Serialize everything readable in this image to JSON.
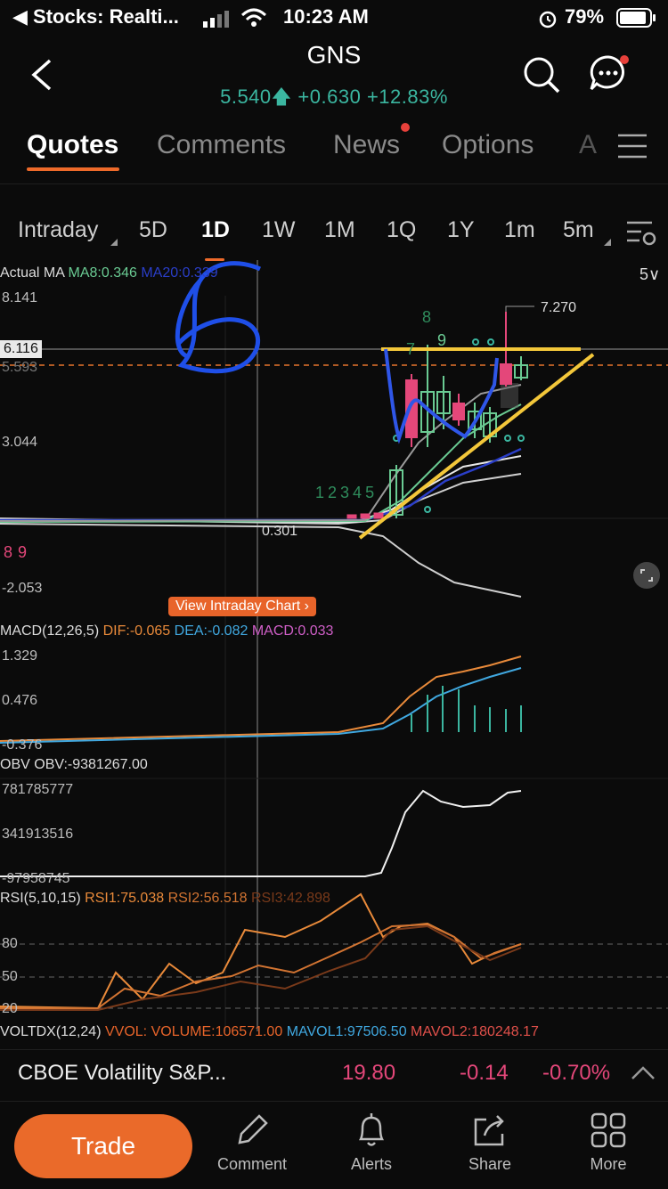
{
  "status_bar": {
    "back_app": "◀ Stocks: Realti...",
    "time": "10:23 AM",
    "battery": "79%"
  },
  "header": {
    "symbol": "GNS",
    "price": "5.540",
    "change": "+0.630",
    "change_pct": "+12.83%",
    "accent_up": "#3bb6a0"
  },
  "tabs": {
    "items": [
      "Quotes",
      "Comments",
      "News",
      "Options",
      "A"
    ],
    "active": "Quotes"
  },
  "periods": {
    "items": [
      "Intraday",
      "5D",
      "1D",
      "1W",
      "1M",
      "1Q",
      "1Y",
      "1m",
      "5m"
    ],
    "active": "1D"
  },
  "main_chart": {
    "labels": {
      "actual": "Actual",
      "ma": "MA",
      "ma8": "MA8:0.346",
      "ma20": "MA20:0.339",
      "five_v": "5∨"
    },
    "y_ticks": [
      "8.141",
      "6.116",
      "5.593",
      "3.044",
      "0.301",
      "-2.053"
    ],
    "annotations": {
      "high": "7.270",
      "low": "0.301",
      "seq_green": [
        "1",
        "2",
        "3",
        "4",
        "5",
        "7",
        "8",
        "9"
      ],
      "seq_red": [
        "8",
        "9"
      ]
    },
    "view_intraday_btn": "View Intraday Chart  ›"
  },
  "macd": {
    "title": "MACD(12,26,5)",
    "dif": "DIF:-0.065",
    "dea": "DEA:-0.082",
    "macd": "MACD:0.033",
    "ticks": [
      "1.329",
      "0.476",
      "-0.376"
    ]
  },
  "obv": {
    "title": "OBV",
    "value": "OBV:-9381267.00",
    "ticks": [
      "781785777",
      "341913516",
      "-97958745"
    ]
  },
  "rsi": {
    "title": "RSI(5,10,15)",
    "rsi1": "RSI1:75.038",
    "rsi2": "RSI2:56.518",
    "rsi3": "RSI3:42.898",
    "ticks": [
      "80",
      "50",
      "20"
    ]
  },
  "voltdx": {
    "title": "VOLTDX(12,24)",
    "vvol": "VVOL:",
    "volume": "VOLUME:106571.00",
    "mavol1": "MAVOL1:97506.50",
    "mavol2": "MAVOL2:180248.17"
  },
  "ticker_bar": {
    "name": "CBOE Volatility S&P...",
    "price": "19.80",
    "change": "-0.14",
    "change_pct": "-0.70%",
    "down_color": "#e4477a"
  },
  "bottom_nav": {
    "trade": "Trade",
    "comment": "Comment",
    "alerts": "Alerts",
    "share": "Share",
    "more": "More"
  }
}
